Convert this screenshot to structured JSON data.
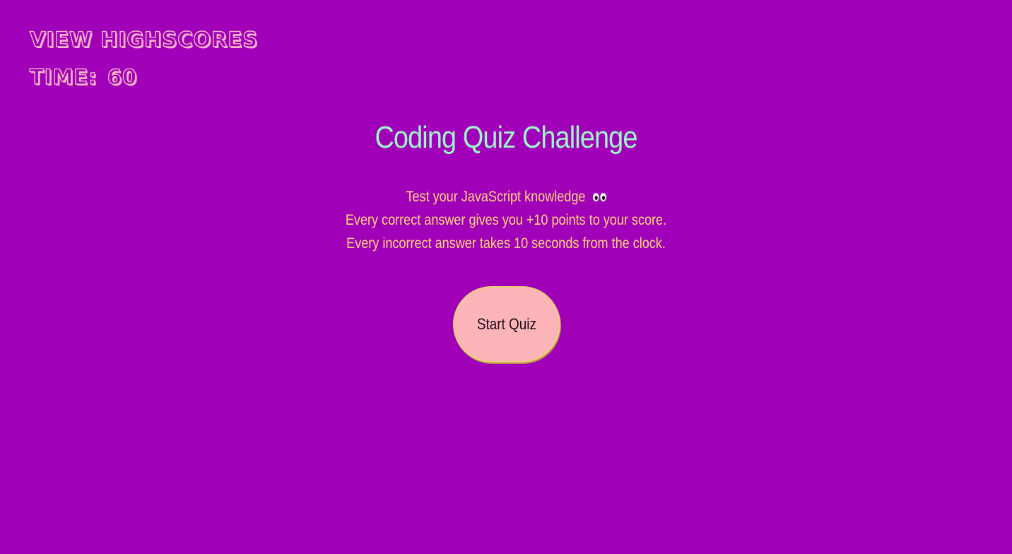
{
  "header": {
    "highscores_label": "View Highscores",
    "time_label": "Time:",
    "time_value": "60"
  },
  "main": {
    "title": "Coding Quiz Challenge",
    "intro_lines": [
      "Test your JavaScript knowledge",
      "Every correct answer gives you +10 points to your score.",
      "Every incorrect answer takes 10 seconds from the clock."
    ],
    "intro_emoji": "eyes-icon",
    "start_label": "Start Quiz"
  },
  "colors": {
    "background": "#9f00b8",
    "header_text": "#f7b6c4",
    "title": "#9ef5c8",
    "intro_text": "#ffd67a",
    "button_bg": "#fdb4b8",
    "button_border": "#e9d178"
  }
}
